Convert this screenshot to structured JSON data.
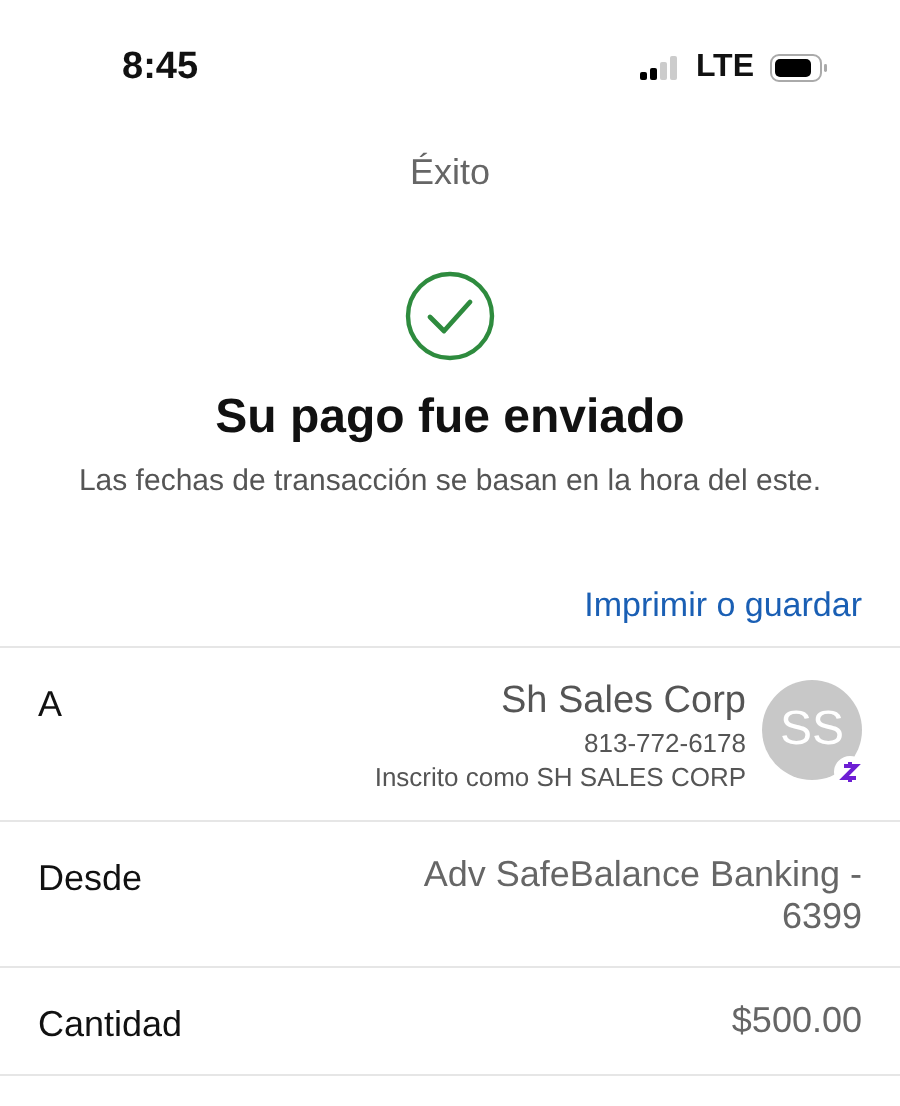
{
  "status_bar": {
    "time": "8:45",
    "network": "LTE"
  },
  "header": {
    "title": "Éxito"
  },
  "confirmation": {
    "headline": "Su pago fue enviado",
    "note": "Las fechas de transacción se basan en la hora del este."
  },
  "print_link": "Imprimir o guardar",
  "details": [
    {
      "kind": "recipient",
      "label": "A",
      "name": "Sh Sales Corp",
      "phone": "813-772-6178",
      "enrolled": "Inscrito como SH SALES CORP",
      "initials": "SS"
    },
    {
      "kind": "text",
      "label": "Desde",
      "value": "Adv SafeBalance Banking - 6399"
    },
    {
      "kind": "text",
      "label": "Cantidad",
      "value": "$500.00"
    }
  ]
}
